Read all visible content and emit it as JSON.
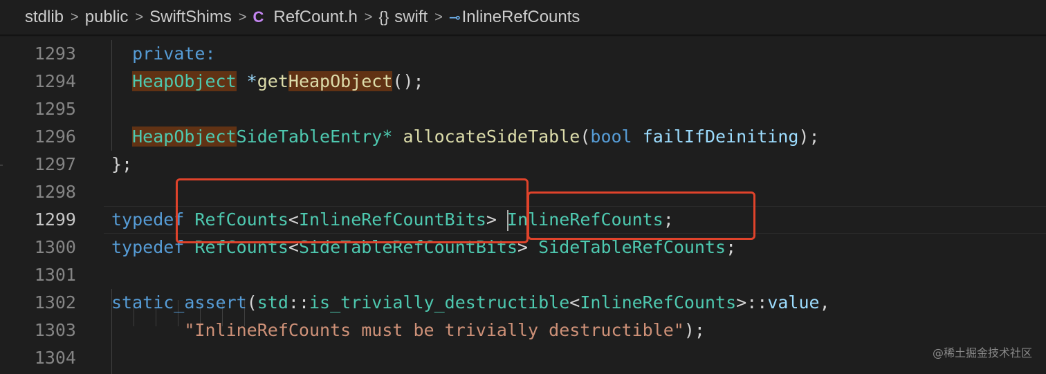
{
  "breadcrumb": {
    "items": [
      "stdlib",
      "public",
      "SwiftShims",
      "RefCount.h",
      "swift",
      "InlineRefCounts"
    ],
    "separator": ">",
    "class_icon_glyph": "C",
    "namespace_icon_glyph": "{}",
    "field_icon_glyph": "⊸"
  },
  "editor": {
    "active_line": "1299",
    "lines": [
      {
        "number": "1293",
        "code": "private:"
      },
      {
        "number": "1294",
        "code": "HeapObject *getHeapObject();"
      },
      {
        "number": "1295",
        "code": ""
      },
      {
        "number": "1296",
        "code": "HeapObjectSideTableEntry* allocateSideTable(bool failIfDeiniting);"
      },
      {
        "number": "1297",
        "code": "};"
      },
      {
        "number": "1298",
        "code": ""
      },
      {
        "number": "1299",
        "code": "typedef RefCounts<InlineRefCountBits> InlineRefCounts;"
      },
      {
        "number": "1300",
        "code": "typedef RefCounts<SideTableRefCountBits> SideTableRefCounts;"
      },
      {
        "number": "1301",
        "code": ""
      },
      {
        "number": "1302",
        "code": "static_assert(std::is_trivially_destructible<InlineRefCounts>::value,"
      },
      {
        "number": "1303",
        "code": "\"InlineRefCounts must be trivially destructible\");"
      },
      {
        "number": "1304",
        "code": ""
      }
    ],
    "tokens": {
      "private": "private:",
      "heap_object": "HeapObject",
      "star": " *",
      "get_prefix": "get",
      "get_heap_object": "HeapObject",
      "call_end": "();",
      "heap_object_2": "HeapObject",
      "side_table_entry": "SideTableEntry",
      "ptr_star": "*",
      "allocate_side_table": "allocateSideTable",
      "open_paren": "(",
      "bool_kw": "bool",
      "param_name": "failIfDeiniting",
      "close_call": ");",
      "close_brace": "};",
      "typedef_kw": "typedef",
      "refcounts": "RefCounts",
      "lt": "<",
      "inline_bits": "InlineRefCountBits",
      "gt": ">",
      "inline_refcounts": "InlineRefCounts",
      "semi": ";",
      "side_bits": "SideTableRefCountBits",
      "side_refcounts": "SideTableRefCounts",
      "static_assert_kw": "static_assert",
      "std_ns": "std",
      "scope": "::",
      "is_trivially_destructible": "is_trivially_destructible",
      "value_kw": "value",
      "comma": ",",
      "message_string": "\"InlineRefCounts must be trivially destructible\""
    }
  },
  "watermark": "@稀土掘金技术社区",
  "colors": {
    "background": "#1e1e1e",
    "keyword": "#569cd6",
    "type": "#4ec9b0",
    "function": "#dcdcaa",
    "parameter": "#9cdcfe",
    "string": "#ce9178",
    "line_number": "#858585",
    "annotation_box": "#e0432b",
    "highlight": "#613214"
  }
}
